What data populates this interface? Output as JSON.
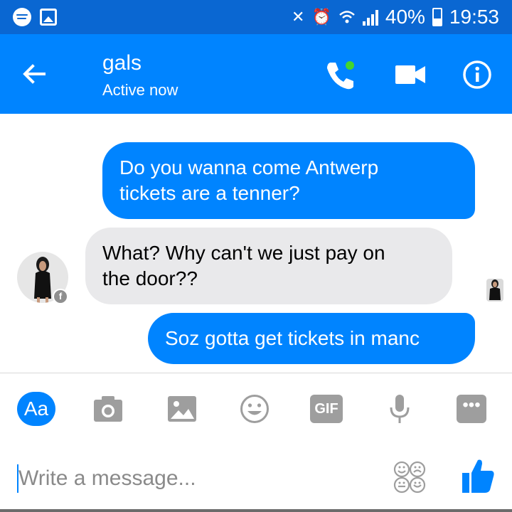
{
  "status_bar": {
    "battery": "40%",
    "battery_level": 0.4,
    "time": "19:53",
    "icons": [
      "spotify-icon",
      "gallery-icon",
      "mute-icon",
      "alarm-icon",
      "wifi-icon",
      "signal-icon",
      "battery-icon"
    ]
  },
  "header": {
    "title": "gals",
    "subtitle": "Active now",
    "colors": {
      "bar": "#0084ff",
      "status_bar": "#0a67d2",
      "online_dot": "#44d62c"
    },
    "icons": [
      "back-arrow-icon",
      "phone-icon",
      "video-camera-icon",
      "info-icon"
    ]
  },
  "chat": {
    "messages": [
      {
        "direction": "outgoing",
        "text": "Do you wanna come Antwerp\ntickets are a tenner?"
      },
      {
        "direction": "incoming",
        "text": "What? Why can't we just pay on\nthe door??"
      },
      {
        "direction": "outgoing",
        "text": "Soz gotta get tickets in manc"
      }
    ],
    "badge": "f",
    "colors": {
      "outgoing": "#0084ff",
      "incoming": "#e9e9eb"
    }
  },
  "composer": {
    "aa_label": "Aa",
    "gif_label": "GIF",
    "more_label": "•••",
    "placeholder": "Write a message...",
    "icons": [
      "text-format-icon",
      "camera-icon",
      "image-icon",
      "emoji-icon",
      "gif-icon",
      "microphone-icon",
      "more-icon",
      "sticker-icon",
      "thumbs-up-icon"
    ]
  }
}
